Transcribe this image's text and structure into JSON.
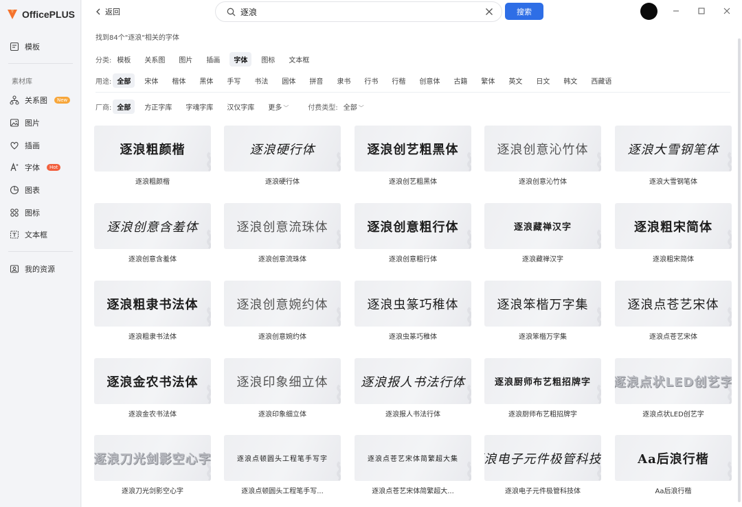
{
  "app": {
    "name": "OfficePLUS",
    "brand_color": "#f5732d",
    "accent": "#2e6ee6"
  },
  "sidebar": {
    "templates": {
      "label": "模板",
      "icon": "template-icon"
    },
    "section_title": "素材库",
    "items": [
      {
        "label": "关系图",
        "icon": "diagram-icon",
        "badge": "New"
      },
      {
        "label": "图片",
        "icon": "image-icon"
      },
      {
        "label": "插画",
        "icon": "illustration-icon"
      },
      {
        "label": "字体",
        "icon": "font-icon",
        "badge": "Hot"
      },
      {
        "label": "图表",
        "icon": "chart-icon"
      },
      {
        "label": "图标",
        "icon": "icons-icon"
      },
      {
        "label": "文本框",
        "icon": "textbox-icon"
      }
    ],
    "my_resources": {
      "label": "我的资源",
      "icon": "resources-icon"
    }
  },
  "topbar": {
    "back_label": "返回",
    "search_value": "逐浪",
    "search_button": "搜索"
  },
  "result_count": "找到84个\"逐浪\"相关的字体",
  "filters": {
    "category": {
      "label": "分类:",
      "options": [
        "模板",
        "关系图",
        "图片",
        "插画",
        "字体",
        "图标",
        "文本框"
      ],
      "active": "字体"
    },
    "usage": {
      "label": "用途:",
      "options": [
        "全部",
        "宋体",
        "楷体",
        "黑体",
        "手写",
        "书法",
        "圆体",
        "拼音",
        "隶书",
        "行书",
        "行楷",
        "创意体",
        "古籍",
        "繁体",
        "英文",
        "日文",
        "韩文",
        "西藏语"
      ],
      "active": "全部"
    },
    "vendor": {
      "label": "厂商:",
      "options": [
        "全部",
        "方正字库",
        "字魂字库",
        "汉仪字库"
      ],
      "active": "全部",
      "more": "更多"
    },
    "pay": {
      "label": "付费类型:",
      "value": "全部"
    }
  },
  "fonts": [
    {
      "name": "逐浪粗颜楷",
      "sample": "逐浪粗颜楷",
      "style": "s-serifb"
    },
    {
      "name": "逐浪硬行体",
      "sample": "逐浪硬行体",
      "style": "s-italic"
    },
    {
      "name": "逐浪创艺粗黑体",
      "sample": "逐浪创艺粗黑体",
      "style": "s-bold"
    },
    {
      "name": "逐浪创意沁竹体",
      "sample": "逐浪创意沁竹体",
      "style": "s-light"
    },
    {
      "name": "逐浪大雪钢笔体",
      "sample": "逐浪大雪钢笔体",
      "style": "s-italic"
    },
    {
      "name": "逐浪创意含羞体",
      "sample": "逐浪创意含羞体",
      "style": "s-italic"
    },
    {
      "name": "逐浪创意流珠体",
      "sample": "逐浪创意流珠体",
      "style": "s-light"
    },
    {
      "name": "逐浪创意粗行体",
      "sample": "逐浪创意粗行体",
      "style": "s-serifb"
    },
    {
      "name": "逐浪藏禅汉字",
      "sample": "逐浪藏禅汉字",
      "style": "s-small"
    },
    {
      "name": "逐浪粗宋简体",
      "sample": "逐浪粗宋简体",
      "style": "s-serifb"
    },
    {
      "name": "逐浪粗隶书法体",
      "sample": "逐浪粗隶书法体",
      "style": "s-serifb"
    },
    {
      "name": "逐浪创意婉约体",
      "sample": "逐浪创意婉约体",
      "style": "s-light"
    },
    {
      "name": "逐浪虫篆巧稚体",
      "sample": "逐浪虫篆巧稚体",
      "style": "s-serif"
    },
    {
      "name": "逐浪笨楷万字集",
      "sample": "逐浪笨楷万字集",
      "style": "s-serif"
    },
    {
      "name": "逐浪点苍艺宋体",
      "sample": "逐浪点苍艺宋体",
      "style": "s-serif"
    },
    {
      "name": "逐浪金农书法体",
      "sample": "逐浪金农书法体",
      "style": "s-serifb"
    },
    {
      "name": "逐浪印象细立体",
      "sample": "逐浪印象细立体",
      "style": "s-light"
    },
    {
      "name": "逐浪报人书法行体",
      "sample": "逐浪报人书法行体",
      "style": "s-italic"
    },
    {
      "name": "逐浪厨师布艺粗招牌字",
      "sample": "逐浪厨师布艺粗招牌字",
      "style": "s-small"
    },
    {
      "name": "逐浪点状LED创艺字",
      "sample": "逐浪点状LED创艺字",
      "style": "s-ghost"
    },
    {
      "name": "逐浪刀光剑影空心字",
      "sample": "逐浪刀光剑影空心字",
      "style": "s-ghost"
    },
    {
      "name": "逐浪点顿圆头工程笔手写...",
      "sample": "逐浪点顿圆头工程笔手写字",
      "style": "s-tiny"
    },
    {
      "name": "逐浪点苍艺宋体简繁超大...",
      "sample": "逐浪点苍艺宋体简繁超大集",
      "style": "s-tiny"
    },
    {
      "name": "逐浪电子元件极管科技体",
      "sample": "逐浪电子元件极管科技体",
      "style": "s-italic"
    },
    {
      "name": "Aa后浪行楷",
      "sample": "Aa后浪行楷",
      "style": "s-serifb"
    }
  ]
}
